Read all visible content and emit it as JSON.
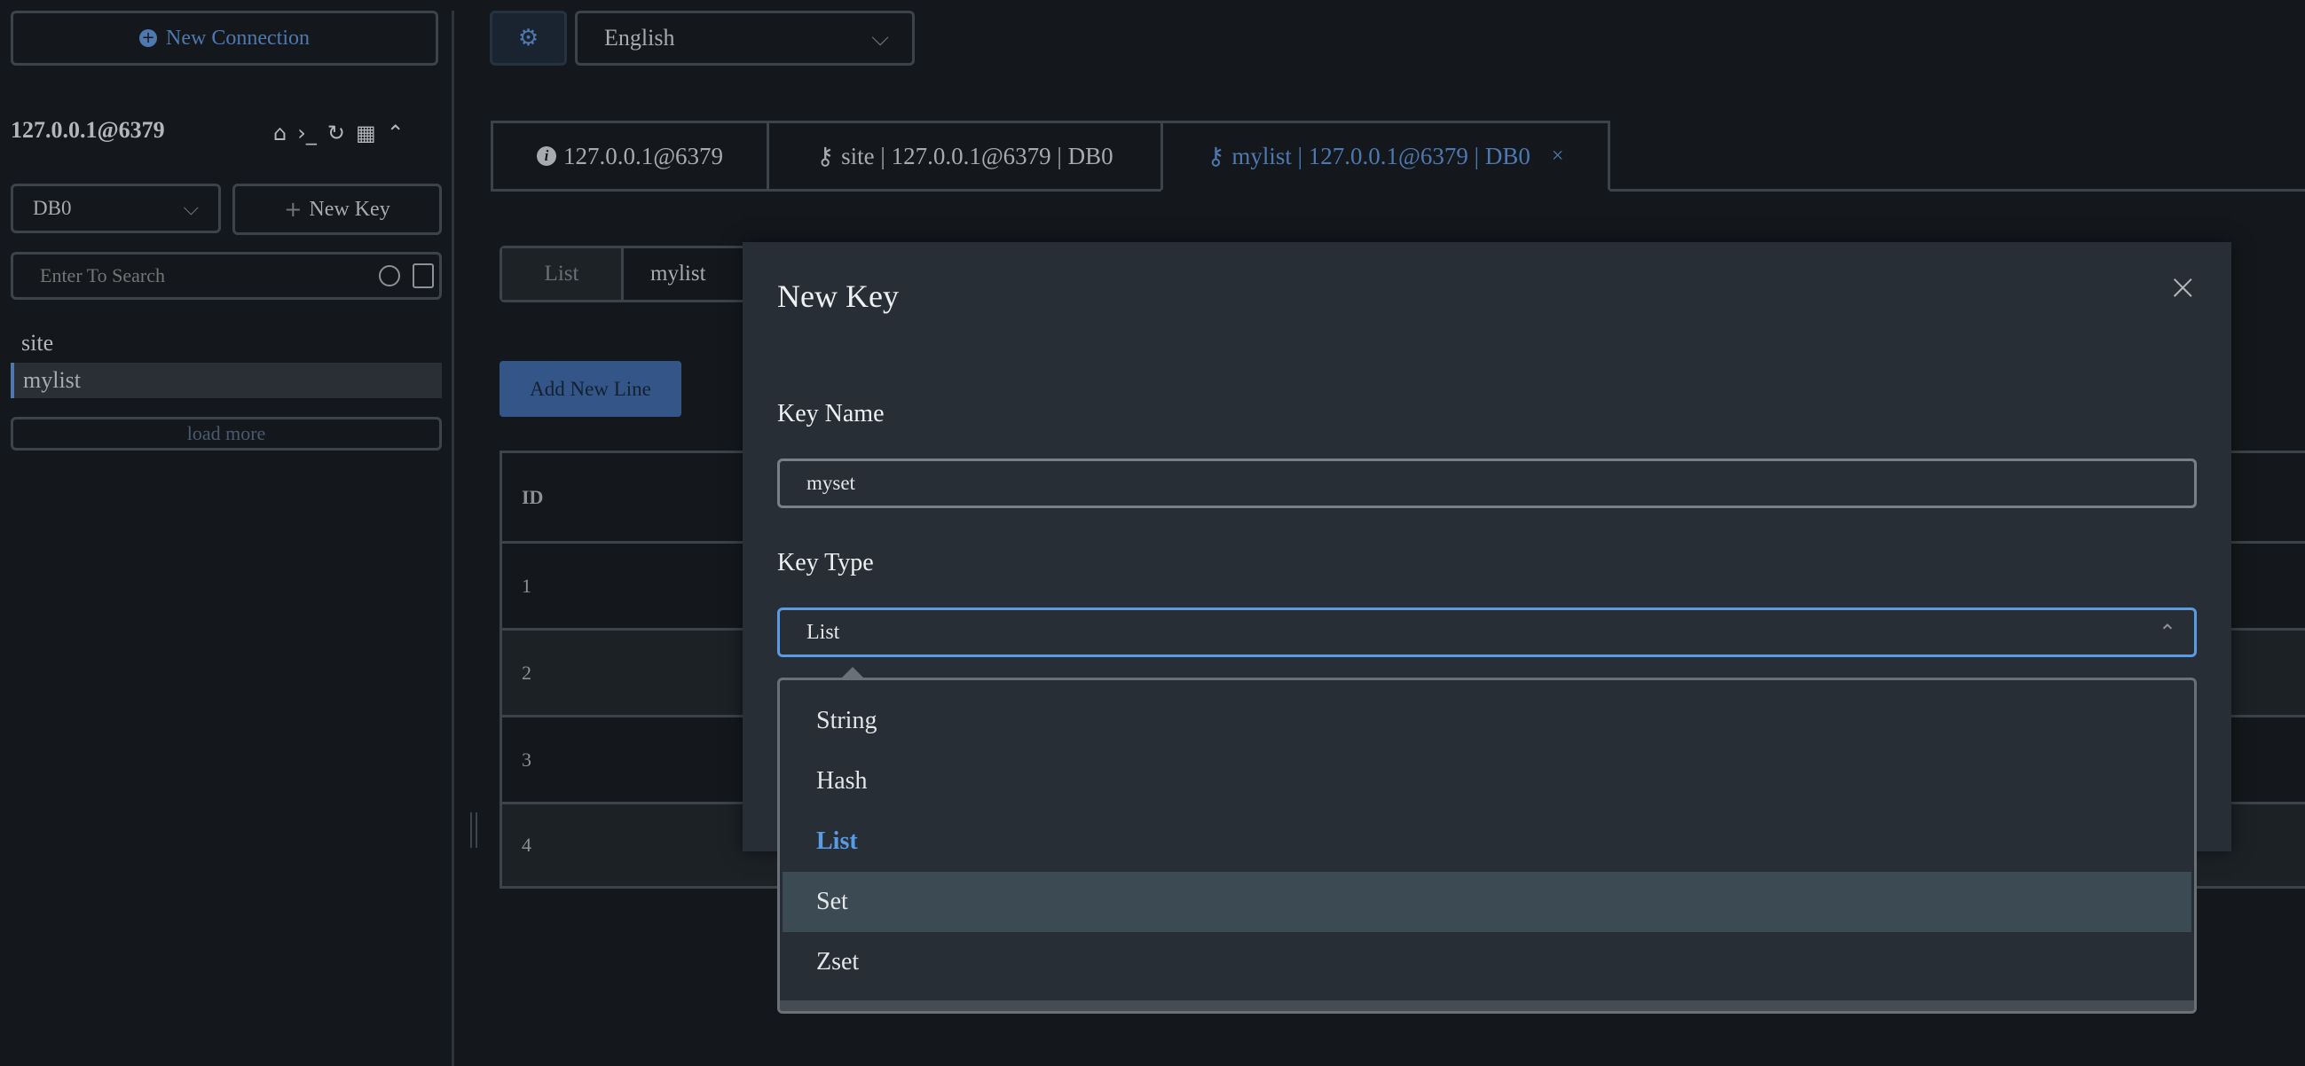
{
  "sidebar": {
    "new_connection": "New Connection",
    "connection_name": "127.0.0.1@6379",
    "db_select": "DB0",
    "new_key": "New Key",
    "search_placeholder": "Enter To Search",
    "keys": [
      "site",
      "mylist"
    ],
    "selected_key": "mylist",
    "load_more": "load more"
  },
  "topbar": {
    "language": "English"
  },
  "tabs": [
    {
      "label": "127.0.0.1@6379",
      "icon": "info-icon"
    },
    {
      "label": "site | 127.0.0.1@6379 | DB0",
      "icon": "key-icon"
    },
    {
      "label": "mylist | 127.0.0.1@6379 | DB0",
      "icon": "key-icon",
      "active": true,
      "close": "×"
    }
  ],
  "key_view": {
    "type": "List",
    "name": "mylist",
    "add_line": "Add New Line",
    "table": {
      "header": "ID",
      "rows": [
        "1",
        "2",
        "3",
        "4"
      ]
    }
  },
  "modal": {
    "title": "New Key",
    "close": "×",
    "key_name_label": "Key Name",
    "key_name_value": "myset",
    "key_type_label": "Key Type",
    "key_type_value": "List",
    "options": [
      "String",
      "Hash",
      "List",
      "Set",
      "Zset"
    ],
    "selected_option": "List",
    "hovered_option": "Set"
  },
  "colors": {
    "accent": "#5a9be6",
    "primary_button": "#335587",
    "background": "#14181c",
    "modal": "#272e35"
  }
}
